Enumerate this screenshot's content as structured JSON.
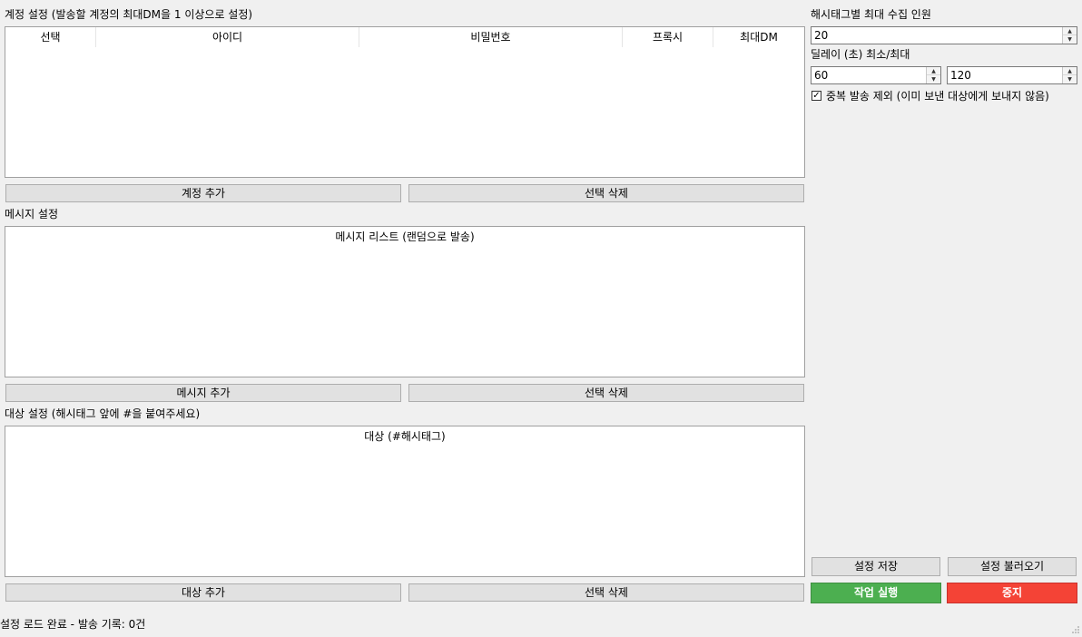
{
  "accounts": {
    "section_label": "계정 설정 (발송할 계정의 최대DM을 1 이상으로 설정)",
    "columns": [
      "선택",
      "아이디",
      "비밀번호",
      "프록시",
      "최대DM"
    ],
    "add_button": "계정 추가",
    "delete_button": "선택 삭제"
  },
  "messages": {
    "section_label": "메시지 설정",
    "list_header": "메시지 리스트 (랜덤으로 발송)",
    "add_button": "메시지 추가",
    "delete_button": "선택 삭제"
  },
  "targets": {
    "section_label": "대상 설정 (해시태그 앞에 #을 붙여주세요)",
    "list_header": "대상 (#해시태그)",
    "add_button": "대상 추가",
    "delete_button": "선택 삭제"
  },
  "settings": {
    "max_collect_label": "해시태그별 최대 수집 인원",
    "max_collect_value": "20",
    "delay_label": "딜레이 (초) 최소/최대",
    "delay_min": "60",
    "delay_max": "120",
    "exclude_dup_label": "중복 발송 제외 (이미 보낸 대상에게 보내지 않음)",
    "exclude_dup_checked": true,
    "save_button": "설정 저장",
    "load_button": "설정 불러오기",
    "run_button": "작업 실행",
    "stop_button": "중지",
    "run_color": "#4caf50",
    "stop_color": "#f44336"
  },
  "status": {
    "text": "설정 로드 완료 - 발송 기록: 0건"
  }
}
